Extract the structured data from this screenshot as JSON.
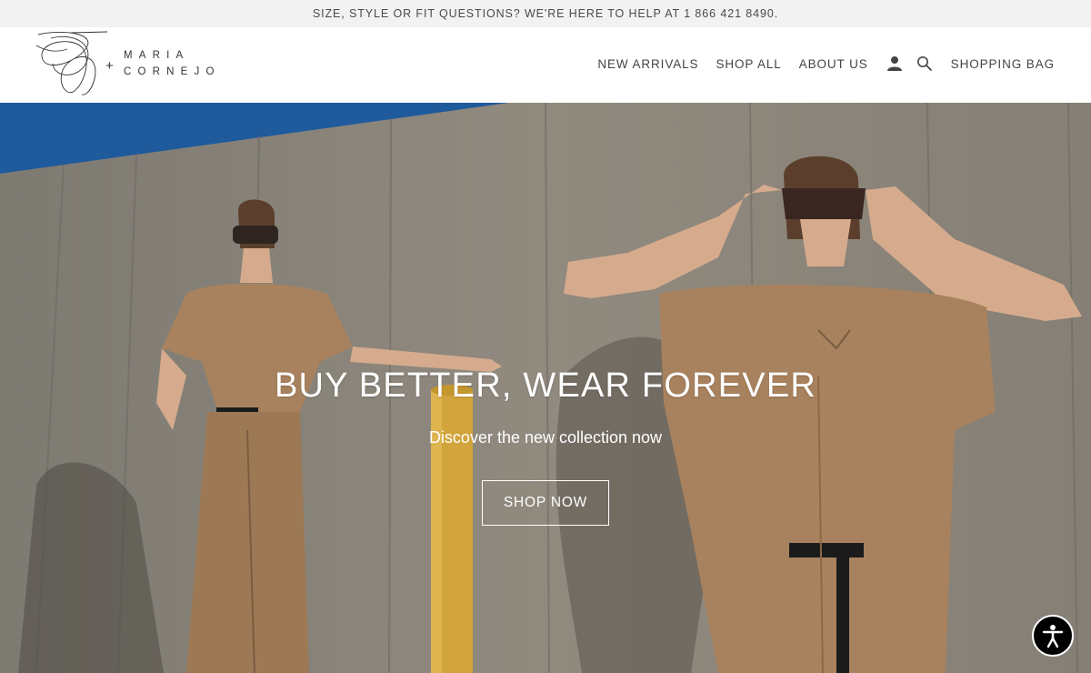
{
  "announcement": {
    "text": "SIZE, STYLE OR FIT QUESTIONS? WE'RE HERE TO HELP AT 1 866 421 8490."
  },
  "brand": {
    "plus": "+",
    "line1": "MARIA",
    "line2": "CORNEJO"
  },
  "nav": {
    "new_arrivals": "NEW ARRIVALS",
    "shop_all": "SHOP ALL",
    "about_us": "ABOUT US",
    "account_icon": "user-icon",
    "search_icon": "search-icon",
    "shopping_bag": "SHOPPING BAG"
  },
  "hero": {
    "title": "BUY BETTER, WEAR FOREVER",
    "subtitle": "Discover the new collection now",
    "cta": "SHOP NOW"
  },
  "accessibility": {
    "icon": "accessibility-icon"
  },
  "colors": {
    "announcement_bg": "#f2f2f2",
    "header_bg": "#ffffff",
    "nav_text": "#444444",
    "hero_text": "#ffffff",
    "sky": "#1f5a9c",
    "wall": "#8d8478",
    "garment": "#a8825e",
    "pole": "#d2a43c"
  }
}
